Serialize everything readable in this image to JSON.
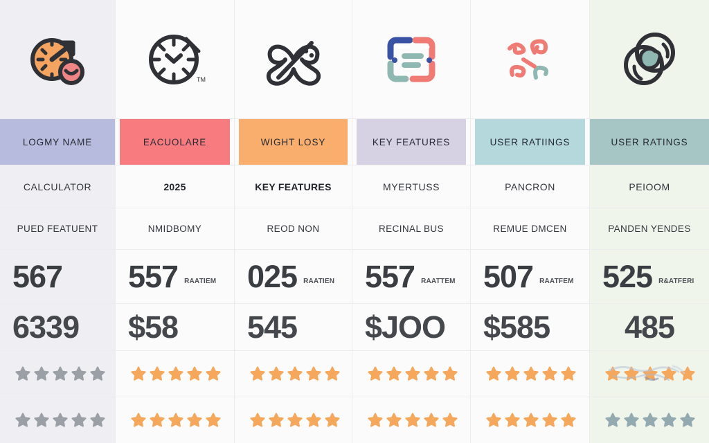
{
  "table": {
    "columns": [
      {
        "icon": "gauge-speedometer-icon",
        "header_label": "LOGMY NAME",
        "header_color": "#b7bbdd",
        "column_tint": "#eeeef3",
        "row_title": "CALCULATOR",
        "row_subtitle": "PUED FEATUENT",
        "metric_a": "567",
        "metric_a_note": "",
        "metric_b": "6339",
        "rating_a": 5,
        "rating_a_color": "#9aa0a6",
        "rating_b": 5,
        "rating_b_color": "#9aa0a6"
      },
      {
        "icon": "clock-icon",
        "header_label": "EACUOLARE",
        "header_color": "#f87c7f",
        "column_tint": "#fbfbfb",
        "row_title": "2025",
        "row_subtitle": "NMIDBOMY",
        "metric_a": "557",
        "metric_a_note": "RAATIEM",
        "metric_b": "$58",
        "rating_a": 5,
        "rating_a_color": "#f5a85c",
        "rating_b": 5,
        "rating_b_color": "#f5a85c"
      },
      {
        "icon": "butterfly-wand-icon",
        "header_label": "WIGHT LOSY",
        "header_color": "#f9ae6e",
        "column_tint": "#fbfbfb",
        "row_title": "KEY FEATURES",
        "row_subtitle": "REOD NON",
        "metric_a": "025",
        "metric_a_note": "RAATIEN",
        "metric_b": "545",
        "rating_a": 5,
        "rating_a_color": "#f5a85c",
        "rating_b": 5,
        "rating_b_color": "#f5a85c"
      },
      {
        "icon": "document-lines-icon",
        "header_label": "KEY FEATURES",
        "header_color": "#d6d2e4",
        "column_tint": "#fbfbfb",
        "row_title": "MYERTUSS",
        "row_subtitle": "RECINAL BUS",
        "metric_a": "557",
        "metric_a_note": "RAATTEM",
        "metric_b": "$JOO",
        "rating_a": 5,
        "rating_a_color": "#f5a85c",
        "rating_b": 5,
        "rating_b_color": "#f5a85c"
      },
      {
        "icon": "scribble-shapes-icon",
        "header_label": "USER RATIINGS",
        "header_color": "#b4d8dc",
        "column_tint": "#fbfbfb",
        "row_title": "PANCRON",
        "row_subtitle": "REMUE DMCEN",
        "metric_a": "507",
        "metric_a_note": "RAATFEM",
        "metric_b": "$585",
        "rating_a": 5,
        "rating_a_color": "#f5a85c",
        "rating_b": 5,
        "rating_b_color": "#f5a85c"
      },
      {
        "icon": "globe-circles-icon",
        "header_label": "USER RATINGS",
        "header_color": "#a6c5c5",
        "column_tint": "#f0f5ec",
        "row_title": "PEIOOM",
        "row_subtitle": "PANDEN YENDES",
        "metric_a": "525",
        "metric_a_note": "R&ATFERI",
        "metric_b": "485",
        "rating_a": 5,
        "rating_a_color": "#f5a85c",
        "rating_b": 5,
        "rating_b_color": "#93aab0"
      }
    ]
  },
  "palette": {
    "orange": "#f4a460",
    "coral": "#f07b74",
    "teal": "#8fb8b2",
    "blue": "#3a52a4",
    "dark": "#2f3136",
    "star_gold": "#f5a85c",
    "star_grey": "#9aa0a6",
    "star_blue_grey": "#93aab0"
  }
}
